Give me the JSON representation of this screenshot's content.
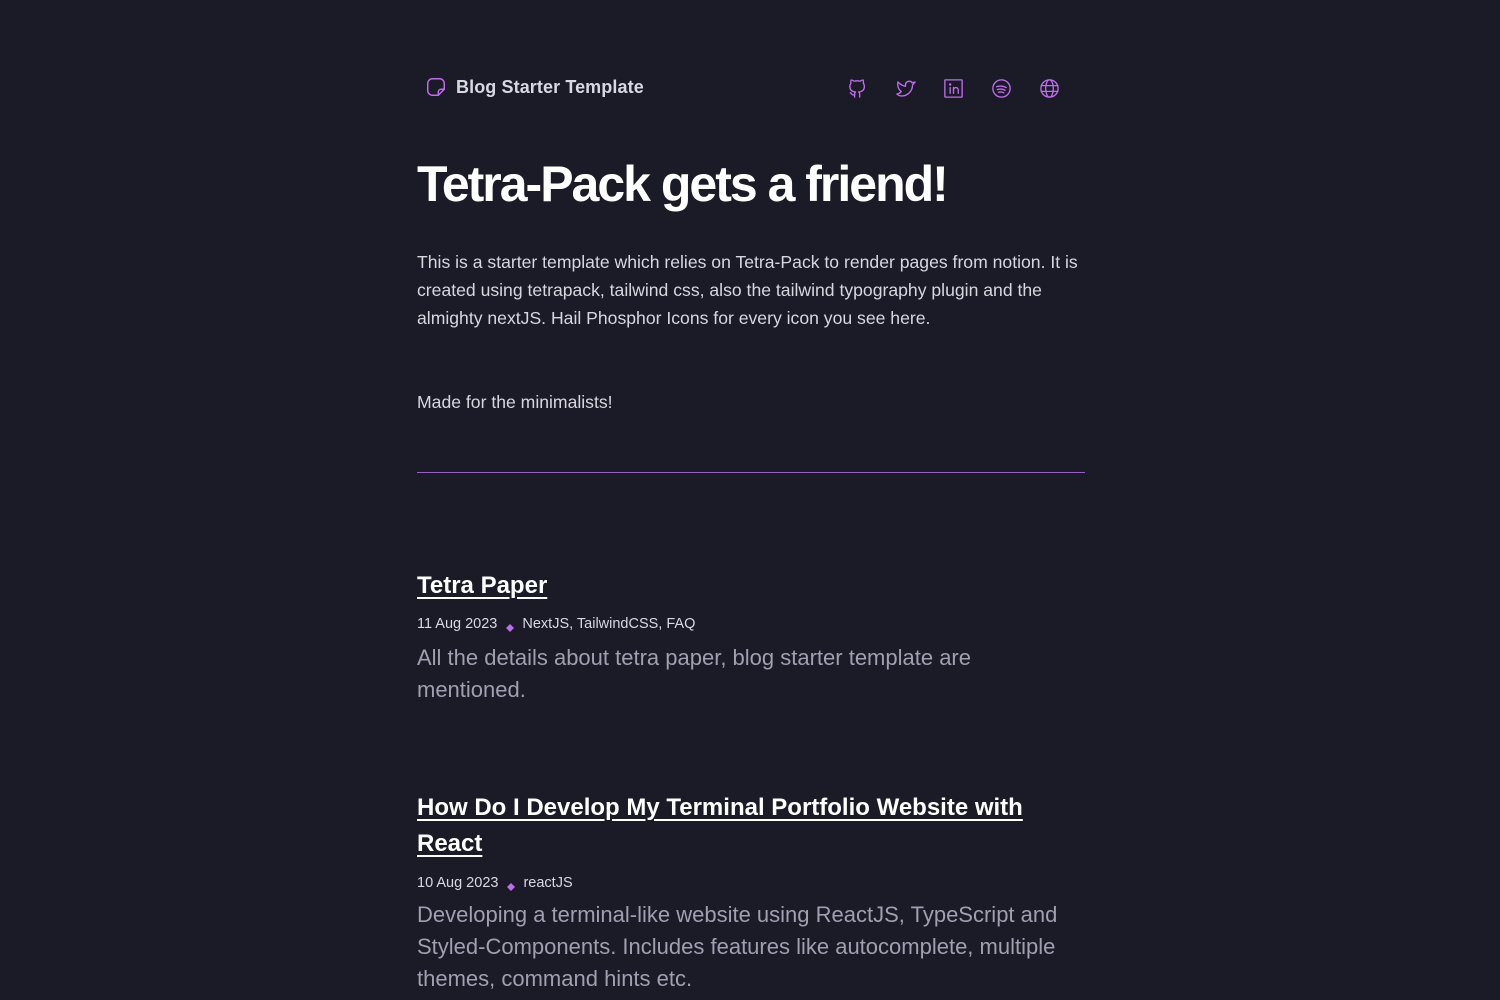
{
  "header": {
    "brand_title": "Blog Starter Template",
    "brand_icon": "sticker-icon",
    "socials": [
      {
        "name": "github-icon"
      },
      {
        "name": "twitter-icon"
      },
      {
        "name": "linkedin-icon"
      },
      {
        "name": "spotify-icon"
      },
      {
        "name": "globe-icon"
      }
    ]
  },
  "hero": {
    "title": "Tetra-Pack gets a friend!",
    "intro": "This is a starter template which relies on Tetra-Pack to render pages from notion. It is created using tetrapack, tailwind css, also the tailwind typography plugin and the almighty nextJS. Hail Phosphor Icons for every icon you see here.",
    "tagline": "Made for the minimalists!"
  },
  "posts": [
    {
      "title": "Tetra Paper",
      "date": "11 Aug 2023",
      "tags": "NextJS, TailwindCSS, FAQ",
      "excerpt": "All the details about tetra paper, blog starter template are mentioned."
    },
    {
      "title": "How Do I Develop My Terminal Portfolio Website with React",
      "date": "10 Aug 2023",
      "tags": "reactJS",
      "excerpt": "Developing a terminal-like website using ReactJS, TypeScript and Styled-Components. Includes features like autocomplete, multiple themes, command hints etc."
    }
  ],
  "colors": {
    "background": "#1b1a27",
    "accent": "#c06cf0",
    "divider": "#9a5ec9",
    "text": "#d8d7e0",
    "muted": "#a19fb0"
  }
}
